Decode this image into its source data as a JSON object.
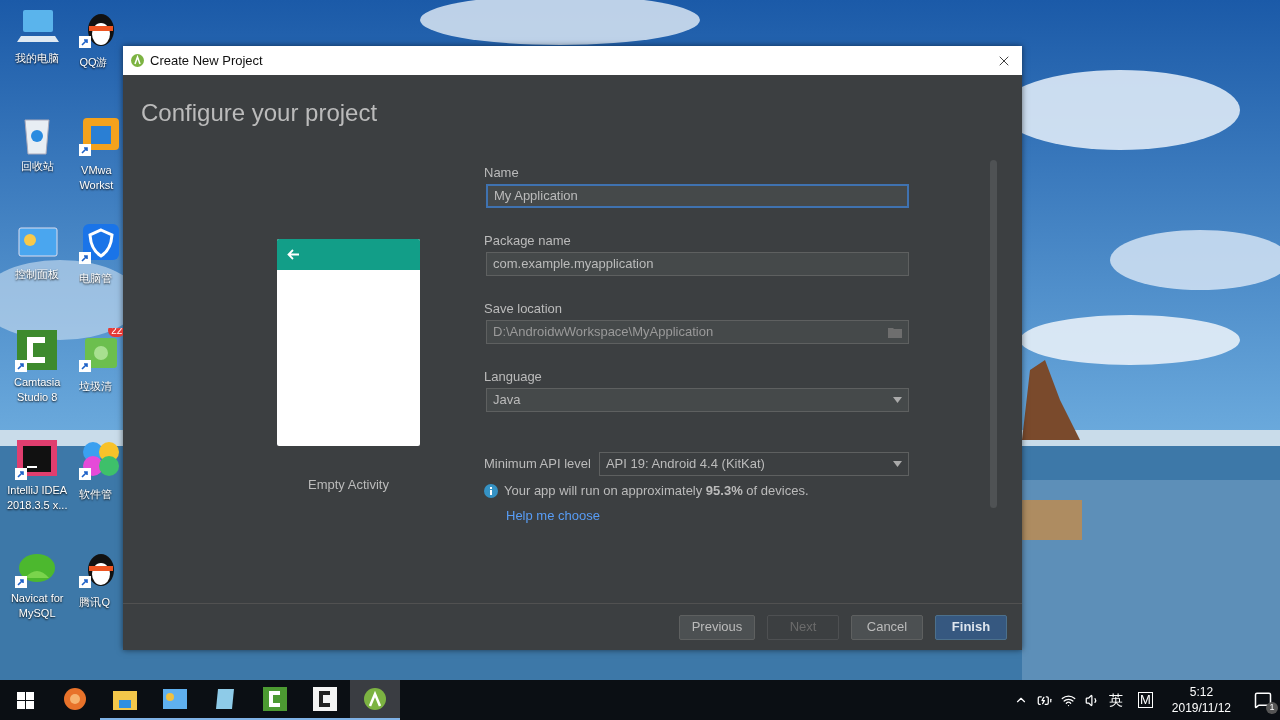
{
  "desktop": {
    "icons": [
      {
        "lines": [
          "我的电脑"
        ]
      },
      {
        "lines": [
          "QQ游"
        ]
      },
      {
        "lines": [
          "回收站"
        ]
      },
      {
        "lines": [
          "VMwa",
          "Workst"
        ]
      },
      {
        "lines": [
          "控制面板"
        ]
      },
      {
        "lines": [
          "电脑管"
        ]
      },
      {
        "lines": [
          "Camtasia",
          "Studio 8"
        ]
      },
      {
        "lines": [
          "垃圾清"
        ]
      },
      {
        "lines": [
          "IntelliJ IDEA",
          "2018.3.5 x..."
        ]
      },
      {
        "lines": [
          "软件管"
        ]
      },
      {
        "lines": [
          "Navicat for",
          "MySQL"
        ]
      },
      {
        "lines": [
          "腾讯Q"
        ]
      }
    ],
    "cleaner_badge": "22"
  },
  "window": {
    "title": "Create New Project",
    "heading": "Configure your project",
    "template": {
      "label": "Empty Activity"
    },
    "fields": [
      {
        "kind": "text",
        "label": "Name",
        "value": "My Application",
        "focused": true
      },
      {
        "kind": "text",
        "label": "Package name",
        "value": "com.example.myapplication",
        "focused": false
      },
      {
        "kind": "path",
        "label": "Save location",
        "value": "D:\\AndroidwWorkspace\\MyApplication",
        "focused": false
      },
      {
        "kind": "dropdown",
        "label": "Language",
        "value": "Java",
        "focused": false
      }
    ],
    "min_api": {
      "label": "Minimum API level",
      "value": "API 19: Android 4.4 (KitKat)"
    },
    "info": "Your app will run on approximately **95.3%** of devices.",
    "help_link": "Help me choose",
    "buttons": [
      {
        "label": "Previous",
        "disabled": false,
        "primary": false
      },
      {
        "label": "Next",
        "disabled": true,
        "primary": false
      },
      {
        "label": "Cancel",
        "disabled": false,
        "primary": false
      },
      {
        "label": "Finish",
        "disabled": false,
        "primary": true
      }
    ]
  },
  "taskbar": {
    "apps": [
      {
        "open": false,
        "selected": false
      },
      {
        "open": true,
        "selected": false
      },
      {
        "open": true,
        "selected": false
      },
      {
        "open": true,
        "selected": false
      },
      {
        "open": true,
        "selected": false
      },
      {
        "open": true,
        "selected": false
      },
      {
        "open": true,
        "selected": true
      }
    ],
    "ime": "英",
    "ime_mode": "M",
    "time": "5:12",
    "date": "2019/11/12",
    "notifications": "1"
  }
}
